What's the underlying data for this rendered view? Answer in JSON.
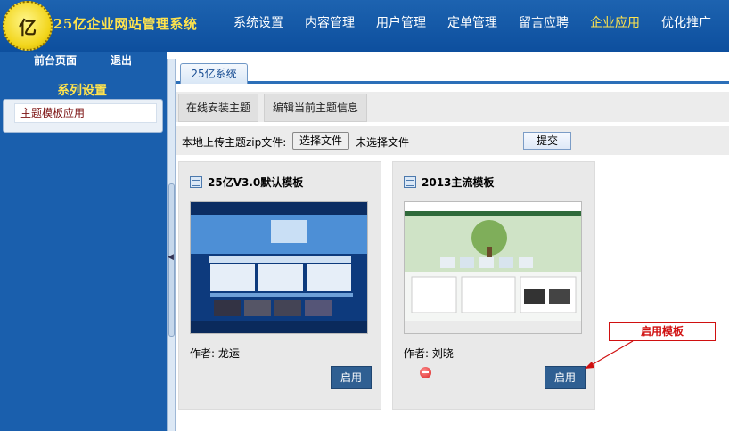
{
  "header": {
    "logo_char": "亿",
    "app_title": "25亿企业网站管理系统",
    "nav": [
      {
        "label": "系统设置",
        "active": false
      },
      {
        "label": "内容管理",
        "active": false
      },
      {
        "label": "用户管理",
        "active": false
      },
      {
        "label": "定单管理",
        "active": false
      },
      {
        "label": "留言应聘",
        "active": false
      },
      {
        "label": "企业应用",
        "active": true
      },
      {
        "label": "优化推广",
        "active": false
      }
    ],
    "accent_color": "#ffe34d"
  },
  "sidebar": {
    "links": [
      "前台页面",
      "退出"
    ],
    "section_title": "系列设置",
    "items": [
      {
        "label": "主题模板应用"
      }
    ]
  },
  "main": {
    "tab_label": "25亿系统",
    "subtabs": [
      "在线安装主题",
      "编辑当前主题信息"
    ],
    "upload": {
      "label": "本地上传主题zip文件:",
      "choose_button": "选择文件",
      "no_file_text": "未选择文件",
      "submit_button": "提交"
    },
    "cards": [
      {
        "title": "25亿V3.0默认模板",
        "author": "作者: 龙运",
        "button": "启用",
        "has_delete": false
      },
      {
        "title": "2013主流模板",
        "author": "作者: 刘晓",
        "button": "启用",
        "has_delete": true
      }
    ]
  },
  "annotation": {
    "label": "启用模板",
    "color": "#d01010"
  }
}
